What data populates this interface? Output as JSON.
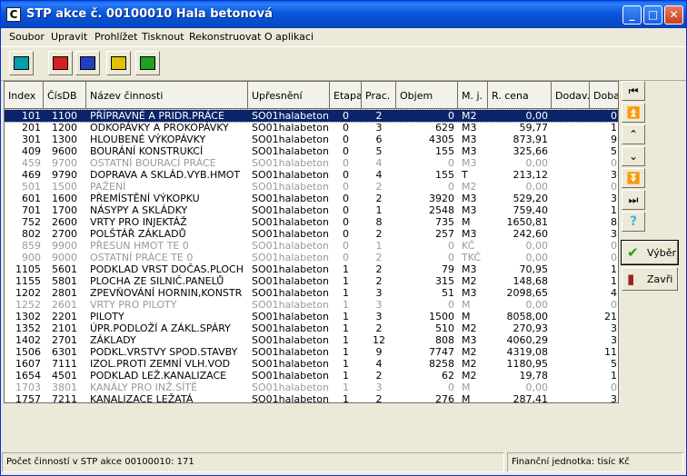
{
  "window": {
    "title": "STP akce č. 00100010 Hala betonová",
    "app_icon": "C",
    "minimize": "_",
    "maximize": "□",
    "close": "✕"
  },
  "menu": [
    "Soubor",
    "Upravit",
    "Prohlížet",
    "Tisknout",
    "Rekonstruovat",
    "O aplikaci"
  ],
  "toolbar": {
    "buttons": [
      {
        "name": "tree-icon",
        "color": "#00a0a8"
      },
      {
        "name": "structure-icon",
        "color": "#d82020"
      },
      {
        "name": "table-icon",
        "color": "#2040c0"
      },
      {
        "name": "chart-icon",
        "color": "#e0c000"
      },
      {
        "name": "list-icon",
        "color": "#20a020"
      }
    ]
  },
  "grid": {
    "columns": [
      "Index",
      "ČísDB",
      "Název činnosti",
      "Upřesnění",
      "Etapa",
      "Prac.",
      "Objem",
      "M. j.",
      "R. cena",
      "Dodav.",
      "Doba"
    ],
    "rows": [
      {
        "index": "101",
        "cisdb": "1100",
        "nazev": "PŘÍPRAVNÉ A PRIDR.PRÁCE",
        "upresneni": "SO01halabeton",
        "etapa": "0",
        "prac": "2",
        "objem": "0",
        "mj": "M2",
        "rcena": "0,00",
        "dodav": "",
        "doba": "0",
        "gray": false,
        "selected": true
      },
      {
        "index": "201",
        "cisdb": "1200",
        "nazev": "ODKOPÁVKY A PROKOPÁVKY",
        "upresneni": "SO01halabeton",
        "etapa": "0",
        "prac": "3",
        "objem": "629",
        "mj": "M3",
        "rcena": "59,77",
        "dodav": "",
        "doba": "1",
        "gray": false,
        "selected": false
      },
      {
        "index": "301",
        "cisdb": "1300",
        "nazev": "HLOUBENÉ VÝKOPÁVKY",
        "upresneni": "SO01halabeton",
        "etapa": "0",
        "prac": "6",
        "objem": "4305",
        "mj": "M3",
        "rcena": "873,91",
        "dodav": "",
        "doba": "9",
        "gray": false,
        "selected": false
      },
      {
        "index": "409",
        "cisdb": "9600",
        "nazev": "BOURÁNÍ KONSTRUKCÍ",
        "upresneni": "SO01halabeton",
        "etapa": "0",
        "prac": "5",
        "objem": "155",
        "mj": "M3",
        "rcena": "325,66",
        "dodav": "",
        "doba": "5",
        "gray": false,
        "selected": false
      },
      {
        "index": "459",
        "cisdb": "9700",
        "nazev": "OSTATNÍ BOURACÍ PRÁCE",
        "upresneni": "SO01halabeton",
        "etapa": "0",
        "prac": "4",
        "objem": "0",
        "mj": "M3",
        "rcena": "0,00",
        "dodav": "",
        "doba": "0",
        "gray": true,
        "selected": false
      },
      {
        "index": "469",
        "cisdb": "9790",
        "nazev": "DOPRAVA A SKLÁD.VYB.HMOT",
        "upresneni": "SO01halabeton",
        "etapa": "0",
        "prac": "4",
        "objem": "155",
        "mj": "T",
        "rcena": "213,12",
        "dodav": "",
        "doba": "3",
        "gray": false,
        "selected": false
      },
      {
        "index": "501",
        "cisdb": "1500",
        "nazev": "PAŽENÍ",
        "upresneni": "SO01halabeton",
        "etapa": "0",
        "prac": "2",
        "objem": "0",
        "mj": "M2",
        "rcena": "0,00",
        "dodav": "",
        "doba": "0",
        "gray": true,
        "selected": false
      },
      {
        "index": "601",
        "cisdb": "1600",
        "nazev": "PŘEMÍSTĚNÍ VÝKOPKU",
        "upresneni": "SO01halabeton",
        "etapa": "0",
        "prac": "2",
        "objem": "3920",
        "mj": "M3",
        "rcena": "529,20",
        "dodav": "",
        "doba": "3",
        "gray": false,
        "selected": false
      },
      {
        "index": "701",
        "cisdb": "1700",
        "nazev": "NÁSYPY A SKLÁDKY",
        "upresneni": "SO01halabeton",
        "etapa": "0",
        "prac": "1",
        "objem": "2548",
        "mj": "M3",
        "rcena": "759,40",
        "dodav": "",
        "doba": "1",
        "gray": false,
        "selected": false
      },
      {
        "index": "752",
        "cisdb": "2600",
        "nazev": "VRTY PRO INJEKTÁŽ",
        "upresneni": "SO01halabeton",
        "etapa": "0",
        "prac": "8",
        "objem": "735",
        "mj": "M",
        "rcena": "1650,81",
        "dodav": "",
        "doba": "8",
        "gray": false,
        "selected": false
      },
      {
        "index": "802",
        "cisdb": "2700",
        "nazev": "POLŠTÁŘ ZÁKLADŮ",
        "upresneni": "SO01halabeton",
        "etapa": "0",
        "prac": "2",
        "objem": "257",
        "mj": "M3",
        "rcena": "242,60",
        "dodav": "",
        "doba": "3",
        "gray": false,
        "selected": false
      },
      {
        "index": "859",
        "cisdb": "9900",
        "nazev": "PŘESUN HMOT TE 0",
        "upresneni": "SO01halabeton",
        "etapa": "0",
        "prac": "1",
        "objem": "0",
        "mj": "KČ",
        "rcena": "0,00",
        "dodav": "",
        "doba": "0",
        "gray": true,
        "selected": false
      },
      {
        "index": "900",
        "cisdb": "9000",
        "nazev": "OSTATNÍ PRÁCE TE 0",
        "upresneni": "SO01halabeton",
        "etapa": "0",
        "prac": "2",
        "objem": "0",
        "mj": "TKČ",
        "rcena": "0,00",
        "dodav": "",
        "doba": "0",
        "gray": true,
        "selected": false
      },
      {
        "index": "1105",
        "cisdb": "5601",
        "nazev": "PODKLAD VRST DOČAS.PLOCH",
        "upresneni": "SO01halabeton",
        "etapa": "1",
        "prac": "2",
        "objem": "79",
        "mj": "M3",
        "rcena": "70,95",
        "dodav": "",
        "doba": "1",
        "gray": false,
        "selected": false
      },
      {
        "index": "1155",
        "cisdb": "5801",
        "nazev": "PLOCHA ZE SILNIČ.PANELŮ",
        "upresneni": "SO01halabeton",
        "etapa": "1",
        "prac": "2",
        "objem": "315",
        "mj": "M2",
        "rcena": "148,68",
        "dodav": "",
        "doba": "1",
        "gray": false,
        "selected": false
      },
      {
        "index": "1202",
        "cisdb": "2801",
        "nazev": "ZPEVŇOVÁNÍ HORNIN,KONSTR",
        "upresneni": "SO01halabeton",
        "etapa": "1",
        "prac": "3",
        "objem": "51",
        "mj": "M3",
        "rcena": "2098,65",
        "dodav": "",
        "doba": "4",
        "gray": false,
        "selected": false
      },
      {
        "index": "1252",
        "cisdb": "2601",
        "nazev": "VRTY PRO PILOTY",
        "upresneni": "SO01halabeton",
        "etapa": "1",
        "prac": "3",
        "objem": "0",
        "mj": "M",
        "rcena": "0,00",
        "dodav": "",
        "doba": "0",
        "gray": true,
        "selected": false
      },
      {
        "index": "1302",
        "cisdb": "2201",
        "nazev": "PILOTY",
        "upresneni": "SO01halabeton",
        "etapa": "1",
        "prac": "3",
        "objem": "1500",
        "mj": "M",
        "rcena": "8058,00",
        "dodav": "",
        "doba": "21",
        "gray": false,
        "selected": false
      },
      {
        "index": "1352",
        "cisdb": "2101",
        "nazev": "ÚPR.PODLOŽÍ A ZÁKL.SPÁRY",
        "upresneni": "SO01halabeton",
        "etapa": "1",
        "prac": "2",
        "objem": "510",
        "mj": "M2",
        "rcena": "270,93",
        "dodav": "",
        "doba": "3",
        "gray": false,
        "selected": false
      },
      {
        "index": "1402",
        "cisdb": "2701",
        "nazev": "ZÁKLADY",
        "upresneni": "SO01halabeton",
        "etapa": "1",
        "prac": "12",
        "objem": "808",
        "mj": "M3",
        "rcena": "4060,29",
        "dodav": "",
        "doba": "3",
        "gray": false,
        "selected": false
      },
      {
        "index": "1506",
        "cisdb": "6301",
        "nazev": "PODKL.VRSTVY SPOD.STAVBY",
        "upresneni": "SO01halabeton",
        "etapa": "1",
        "prac": "9",
        "objem": "7747",
        "mj": "M2",
        "rcena": "4319,08",
        "dodav": "",
        "doba": "11",
        "gray": false,
        "selected": false
      },
      {
        "index": "1607",
        "cisdb": "7111",
        "nazev": "IZOL.PROTI ZEMNÍ VLH.VOD",
        "upresneni": "SO01halabeton",
        "etapa": "1",
        "prac": "4",
        "objem": "8258",
        "mj": "M2",
        "rcena": "1180,95",
        "dodav": "",
        "doba": "5",
        "gray": false,
        "selected": false
      },
      {
        "index": "1654",
        "cisdb": "4501",
        "nazev": "PODKLAD LEŽ.KANALIZACE",
        "upresneni": "SO01halabeton",
        "etapa": "1",
        "prac": "2",
        "objem": "62",
        "mj": "M2",
        "rcena": "19,78",
        "dodav": "",
        "doba": "1",
        "gray": false,
        "selected": false
      },
      {
        "index": "1703",
        "cisdb": "3801",
        "nazev": "KANÁLY PRO INŽ.SÍTĚ",
        "upresneni": "SO01halabeton",
        "etapa": "1",
        "prac": "3",
        "objem": "0",
        "mj": "M",
        "rcena": "0,00",
        "dodav": "",
        "doba": "0",
        "gray": true,
        "selected": false
      },
      {
        "index": "1757",
        "cisdb": "7211",
        "nazev": "KANALIZACE LEŽATÁ",
        "upresneni": "SO01halabeton",
        "etapa": "1",
        "prac": "2",
        "objem": "276",
        "mj": "M",
        "rcena": "287,41",
        "dodav": "",
        "doba": "3",
        "gray": false,
        "selected": false
      }
    ]
  },
  "nav_buttons": [
    {
      "name": "first-record-icon",
      "glyph": "⏮"
    },
    {
      "name": "page-up-icon",
      "glyph": "⏫"
    },
    {
      "name": "previous-record-icon",
      "glyph": "⌃"
    },
    {
      "name": "next-record-icon",
      "glyph": "⌄"
    },
    {
      "name": "page-down-icon",
      "glyph": "⏬"
    },
    {
      "name": "last-record-icon",
      "glyph": "⏭"
    },
    {
      "name": "help-icon",
      "glyph": "?"
    }
  ],
  "actions": {
    "select_label": "Výběr",
    "select_icon": "checkmark-icon",
    "close_label": "Zavři",
    "close_icon": "exit-door-icon"
  },
  "status": {
    "left": "Počet činností v STP akce 00100010: 171",
    "right": "Finanční jednotka: tisíc Kč"
  }
}
